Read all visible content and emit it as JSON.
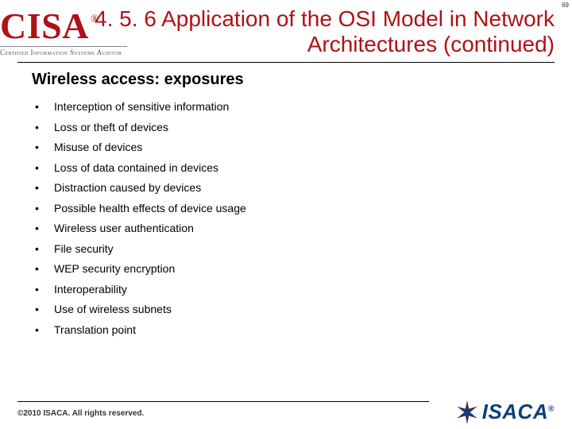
{
  "page_number": "69",
  "logo": {
    "brand": "CISA",
    "registered": "®",
    "subtitle": "Certified Information Systems Auditor"
  },
  "title": "4. 5. 6 Application of the OSI Model in Network Architectures (continued)",
  "subheading": "Wireless access: exposures",
  "bullets": [
    "Interception of sensitive information",
    "Loss or theft of devices",
    "Misuse of devices",
    "Loss of data contained in devices",
    "Distraction caused by devices",
    "Possible health effects of device usage",
    "Wireless user authentication",
    "File security",
    "WEP security encryption",
    "Interoperability",
    "Use of wireless subnets",
    "Translation point"
  ],
  "footer": {
    "copyright": "©2010 ISACA.  All rights reserved.",
    "org": "ISACA",
    "org_reg": "®"
  }
}
